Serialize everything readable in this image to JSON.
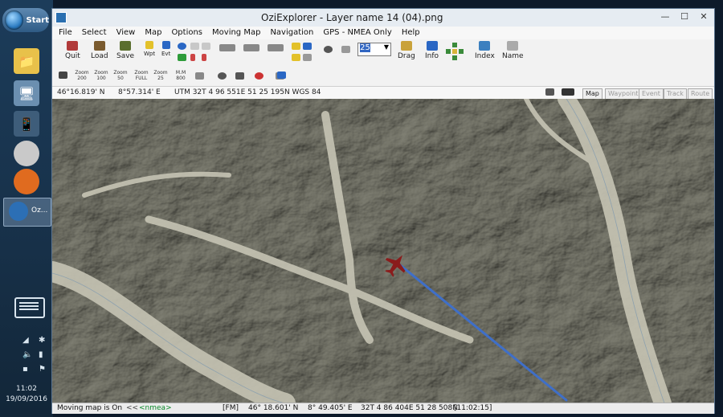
{
  "taskbar": {
    "start_label": "Start",
    "active_app_label": "Oz...",
    "clock_time": "11:02",
    "clock_date": "19/09/2016"
  },
  "window": {
    "title": "OziExplorer - Layer name 14 (04).png"
  },
  "menu": [
    "File",
    "Select",
    "View",
    "Map",
    "Options",
    "Moving Map",
    "Navigation",
    "GPS - NMEA Only",
    "Help"
  ],
  "toolbar": {
    "quit": "Quit",
    "load": "Load",
    "save": "Save",
    "wpt": "Wpt",
    "evt": "Evt",
    "zoom_value": "25",
    "drag": "Drag",
    "info": "Info",
    "index": "Index",
    "name": "Name"
  },
  "toolbar2": {
    "z1": "Zoom 200",
    "z2": "Zoom 100",
    "z3": "Zoom 50",
    "z4": "Zoom FULL",
    "z5": "Zoom 25",
    "mm": "M.M 800"
  },
  "coord_bar": {
    "lat": "46°16.819' N",
    "lon": "8°57.314' E",
    "utm": "UTM 32T  4 96 551E  51 25 195N  WGS 84",
    "tabs": [
      "Map",
      "Waypoint",
      "Event",
      "Track",
      "Route"
    ]
  },
  "status_bar": {
    "moving_map": "Moving map is On",
    "nav_arrows": "<<",
    "nmea": "<nmea>",
    "fm": "[FM]",
    "lat": "46° 18.601' N",
    "lon": "8° 49.405' E",
    "utm": "32T  4 86 404E  51 28 508N",
    "time": "[11:02:15]"
  },
  "colors": {
    "aircraft": "#8a1c1c",
    "track": "#3f6fc8"
  }
}
